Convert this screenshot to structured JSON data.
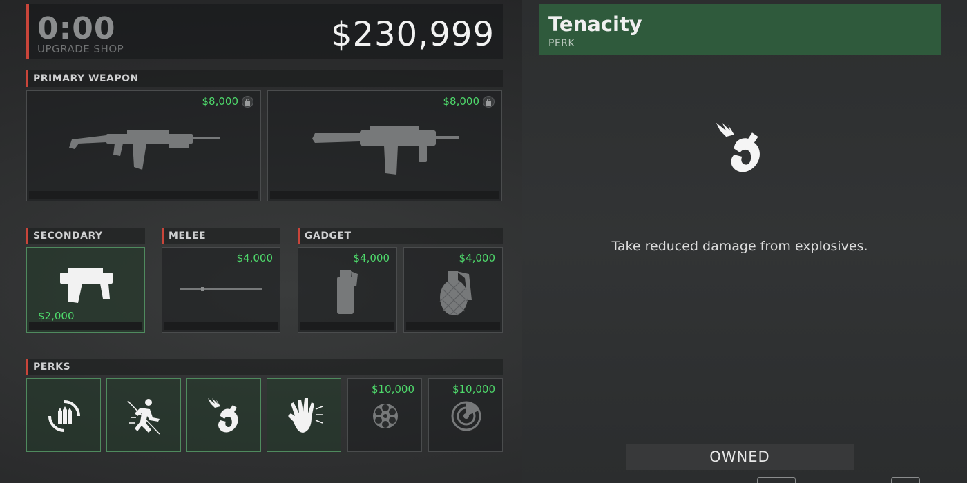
{
  "header": {
    "timer": "0:00",
    "shop_label": "UPGRADE SHOP",
    "money": "$230,999"
  },
  "sections": {
    "primary": "PRIMARY WEAPON",
    "secondary": "SECONDARY",
    "melee": "MELEE",
    "gadget": "GADGET",
    "perks": "PERKS"
  },
  "primary_weapons": [
    {
      "icon": "assault-rifle-icon",
      "price": "$8,000",
      "locked": true
    },
    {
      "icon": "smg-icon",
      "price": "$8,000",
      "locked": true
    }
  ],
  "secondary": {
    "icon": "pistol-icon",
    "price": "$2,000",
    "owned": true
  },
  "melee": {
    "icon": "katana-icon",
    "price": "$4,000"
  },
  "gadgets": [
    {
      "icon": "stun-grenade-icon",
      "price": "$4,000"
    },
    {
      "icon": "frag-grenade-icon",
      "price": "$4,000"
    }
  ],
  "perks": [
    {
      "icon": "ammo-cycle-icon",
      "owned": true
    },
    {
      "icon": "sprinter-icon",
      "owned": true
    },
    {
      "icon": "tenacity-icon",
      "owned": true
    },
    {
      "icon": "quick-hands-icon",
      "owned": true
    },
    {
      "icon": "revolver-cylinder-icon",
      "price": "$10,000"
    },
    {
      "icon": "radar-icon",
      "price": "$10,000"
    }
  ],
  "detail": {
    "name": "Tenacity",
    "type": "PERK",
    "icon": "tenacity-icon",
    "description": "Take reduced damage from explosives.",
    "status": "OWNED"
  },
  "colors": {
    "accent_red": "#c9453a",
    "price_green": "#4ed96b",
    "owned_green": "#2f5a3c"
  }
}
